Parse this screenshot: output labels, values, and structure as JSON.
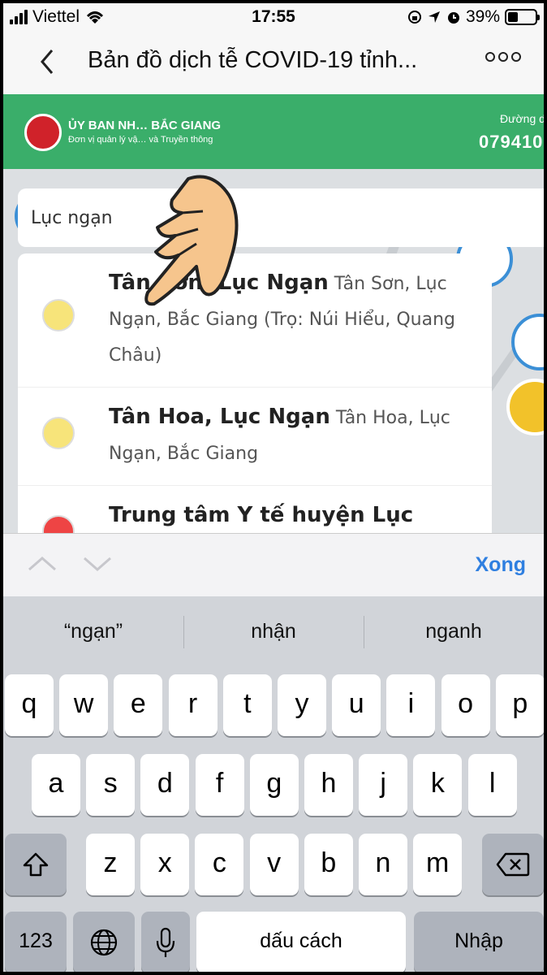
{
  "status_bar": {
    "carrier": "Viettel",
    "time": "17:55",
    "battery_percent": "39%",
    "battery_level": 0.39
  },
  "nav": {
    "title": "Bản đồ dịch tễ COVID-19 tỉnh..."
  },
  "banner": {
    "org": "ỦY BAN NH… BẮC GIANG",
    "unit": "Đơn vị quản lý vậ… và Truyền thông",
    "hotline_label": "Đường d",
    "hotline": "079410"
  },
  "search": {
    "value": "Lục ngạn"
  },
  "results": [
    {
      "name": "Tân Sơn, Lục Ngạn",
      "detail": "Tân Sơn, Lục Ngạn, Bắc Giang (Trọ: Núi Hiểu, Quang Châu)",
      "status": "yellow"
    },
    {
      "name": "Tân Hoa, Lục Ngạn",
      "detail": "Tân Hoa, Lục Ngạn, Bắc Giang",
      "status": "yellow"
    },
    {
      "name": "Trung tâm Y tế huyện Lục",
      "detail": "",
      "status": "red"
    }
  ],
  "accessory": {
    "done_label": "Xong"
  },
  "keyboard": {
    "suggestions": [
      "“ngạn”",
      "nhận",
      "nganh"
    ],
    "row1": [
      "q",
      "w",
      "e",
      "r",
      "t",
      "y",
      "u",
      "i",
      "o",
      "p"
    ],
    "row2": [
      "a",
      "s",
      "d",
      "f",
      "g",
      "h",
      "j",
      "k",
      "l"
    ],
    "row3": [
      "z",
      "x",
      "c",
      "v",
      "b",
      "n",
      "m"
    ],
    "numbers_label": "123",
    "space_label": "dấu cách",
    "return_label": "Nhập"
  }
}
